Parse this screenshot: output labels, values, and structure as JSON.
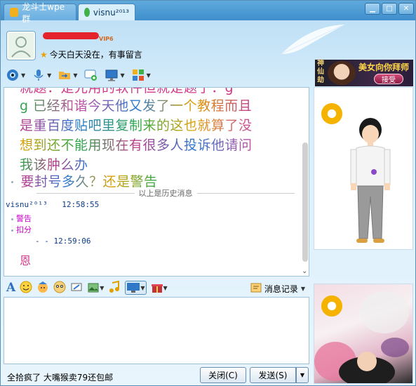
{
  "tabs": [
    {
      "label": "龙斗士wpe群",
      "active": false
    },
    {
      "label": "visnu²⁰¹³",
      "active": true
    }
  ],
  "window_controls": [
    "minimize",
    "maximize",
    "close"
  ],
  "header": {
    "vip_badge": "VIP6",
    "status_message": "今天白天没在，有事留言"
  },
  "ad": {
    "side_text": "神仙劫",
    "title": "美女向你拜师",
    "button": "接受"
  },
  "history": {
    "lines": [
      {
        "text": "就题：是光用的软件但就是题了：g",
        "partial": true
      },
      {
        "text": "g 已经和谐今天他又发了一个教程而且"
      },
      {
        "text": "是重百度贴吧里复制来的这也就算了没"
      },
      {
        "text": "想到还不能用现在有很多人投诉他请问"
      },
      {
        "text": "我该肿么办"
      },
      {
        "text": "要封号多久？还是警告"
      }
    ],
    "divider": "以上是历史消息",
    "message": {
      "sender": "visnu²⁰¹³",
      "time": "12:58:55",
      "items": [
        "警告",
        "扣分"
      ],
      "time2": "-    -  12:59:06",
      "reply": "恩"
    }
  },
  "input_toolbar": {
    "message_record_label": "消息记录"
  },
  "bottom": {
    "status_text": "全拾疯了 大嘴猴卖79还包邮",
    "close_button": "关闭(C)",
    "send_button": "发送(S)"
  },
  "colors": {
    "accent": "#3f8fcd",
    "panel_border": "#9fc3dd"
  }
}
